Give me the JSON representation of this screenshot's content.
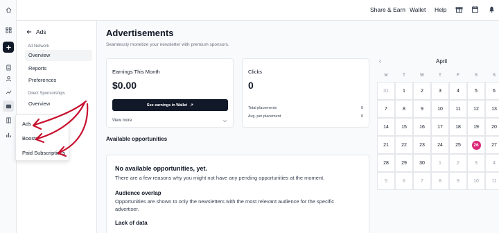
{
  "topbar": {
    "share_earn": "Share & Earn",
    "wallet": "Wallet",
    "help": "Help"
  },
  "sidebar": {
    "back_label": "Ads",
    "section_ad_network": "Ad Network",
    "items_ad_network": [
      "Overview",
      "Reports",
      "Preferences"
    ],
    "section_direct": "Direct Sponsorships",
    "items_direct": [
      "Overview"
    ]
  },
  "popup": {
    "items": [
      "Ads",
      "Boosts",
      "Paid Subscriptions"
    ]
  },
  "main": {
    "title": "Advertisements",
    "subtitle": "Seamlessly monetize your newsletter with premium sponsors.",
    "earnings": {
      "label": "Earnings This Month",
      "value": "$0.00",
      "button": "See earnings in Wallet",
      "view_more": "View more"
    },
    "clicks": {
      "label": "Clicks",
      "value": "0",
      "rows": [
        {
          "label": "Total placements",
          "value": "0"
        },
        {
          "label": "Avg. per placement",
          "value": "0"
        }
      ]
    },
    "available_heading": "Available opportunities",
    "empty": {
      "title": "No available opportunities, yet.",
      "desc": "There are a few reasons why you might not have any pending opportunities at the moment.",
      "overlap_title": "Audience overlap",
      "overlap_desc": "Opportunities are shown to only the newsletters with the most relevant audience for the specific",
      "overlap_desc2": "advertiser.",
      "lack_title": "Lack of data"
    }
  },
  "calendar": {
    "month": "April",
    "weekdays": [
      "M",
      "T",
      "W",
      "T",
      "F",
      "S",
      "S"
    ],
    "weeks": [
      [
        {
          "d": "31",
          "dim": true
        },
        {
          "d": "1"
        },
        {
          "d": "2"
        },
        {
          "d": "3"
        },
        {
          "d": "4"
        },
        {
          "d": "5"
        },
        {
          "d": "6"
        }
      ],
      [
        {
          "d": "7"
        },
        {
          "d": "8"
        },
        {
          "d": "9"
        },
        {
          "d": "10"
        },
        {
          "d": "11"
        },
        {
          "d": "12"
        },
        {
          "d": "13"
        }
      ],
      [
        {
          "d": "14"
        },
        {
          "d": "15"
        },
        {
          "d": "16"
        },
        {
          "d": "17"
        },
        {
          "d": "18"
        },
        {
          "d": "19"
        },
        {
          "d": "20"
        }
      ],
      [
        {
          "d": "21"
        },
        {
          "d": "22"
        },
        {
          "d": "23"
        },
        {
          "d": "24"
        },
        {
          "d": "25"
        },
        {
          "d": "26",
          "today": true
        },
        {
          "d": "27"
        }
      ],
      [
        {
          "d": "28"
        },
        {
          "d": "29"
        },
        {
          "d": "30"
        },
        {
          "d": "1",
          "dim": true
        },
        {
          "d": "2",
          "dim": true
        },
        {
          "d": "3",
          "dim": true
        },
        {
          "d": "4",
          "dim": true
        }
      ],
      [
        {
          "d": "5",
          "dim": true
        },
        {
          "d": "6",
          "dim": true
        },
        {
          "d": "7",
          "dim": true
        },
        {
          "d": "8",
          "dim": true
        },
        {
          "d": "9",
          "dim": true
        },
        {
          "d": "10",
          "dim": true
        },
        {
          "d": "11",
          "dim": true
        }
      ]
    ],
    "today_color": "#db2777"
  },
  "colors": {
    "annotation": "#c8102e",
    "primary_button": "#111827"
  }
}
